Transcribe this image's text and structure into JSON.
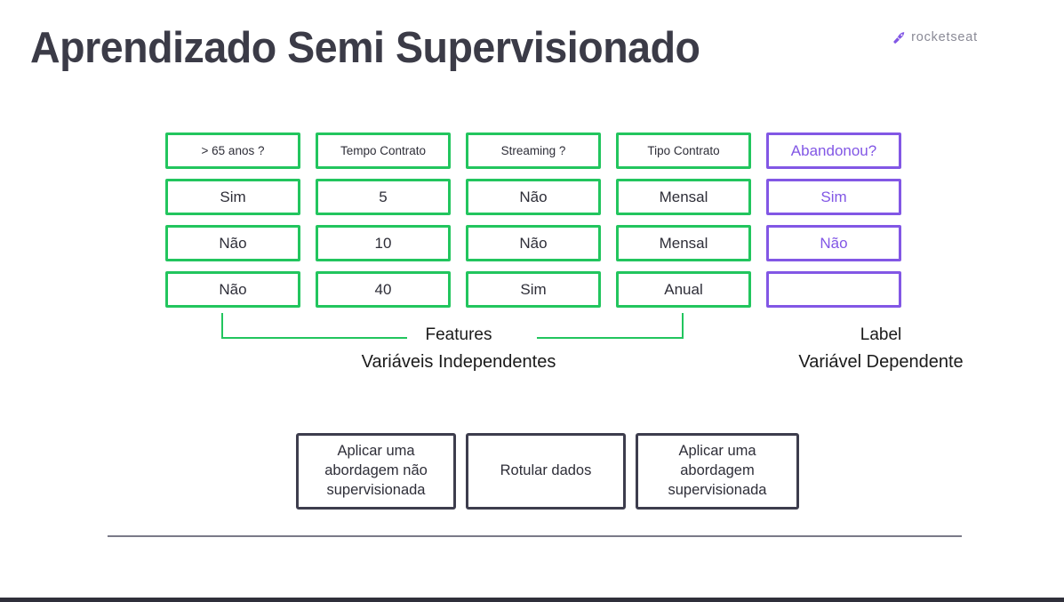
{
  "slide": {
    "title": "Aprendizado Semi Supervisionado",
    "brand": {
      "name": "rocketseat",
      "icon": "rocket-icon",
      "color": "#8257e5"
    }
  },
  "colors": {
    "feature_green": "#22c55e",
    "label_purple": "#8257e5",
    "text_dark": "#2e2e38",
    "title_dark": "#3b3b47",
    "box_border_dark": "#3d3d4d"
  },
  "table": {
    "headers": [
      "> 65 anos ?",
      "Tempo Contrato",
      "Streaming ?",
      "Tipo Contrato",
      "Abandonou?"
    ],
    "rows": [
      [
        "Sim",
        "5",
        "Não",
        "Mensal",
        "Sim"
      ],
      [
        "Não",
        "10",
        "Não",
        "Mensal",
        "Não"
      ],
      [
        "Não",
        "40",
        "Sim",
        "Anual",
        ""
      ]
    ]
  },
  "annotations": {
    "features_label": "Features",
    "features_sublabel": "Variáveis Independentes",
    "label_label": "Label",
    "label_sublabel": "Variável Dependente"
  },
  "steps": [
    "Aplicar uma abordagem não supervisionada",
    "Rotular dados",
    "Aplicar uma abordagem supervisionada"
  ]
}
